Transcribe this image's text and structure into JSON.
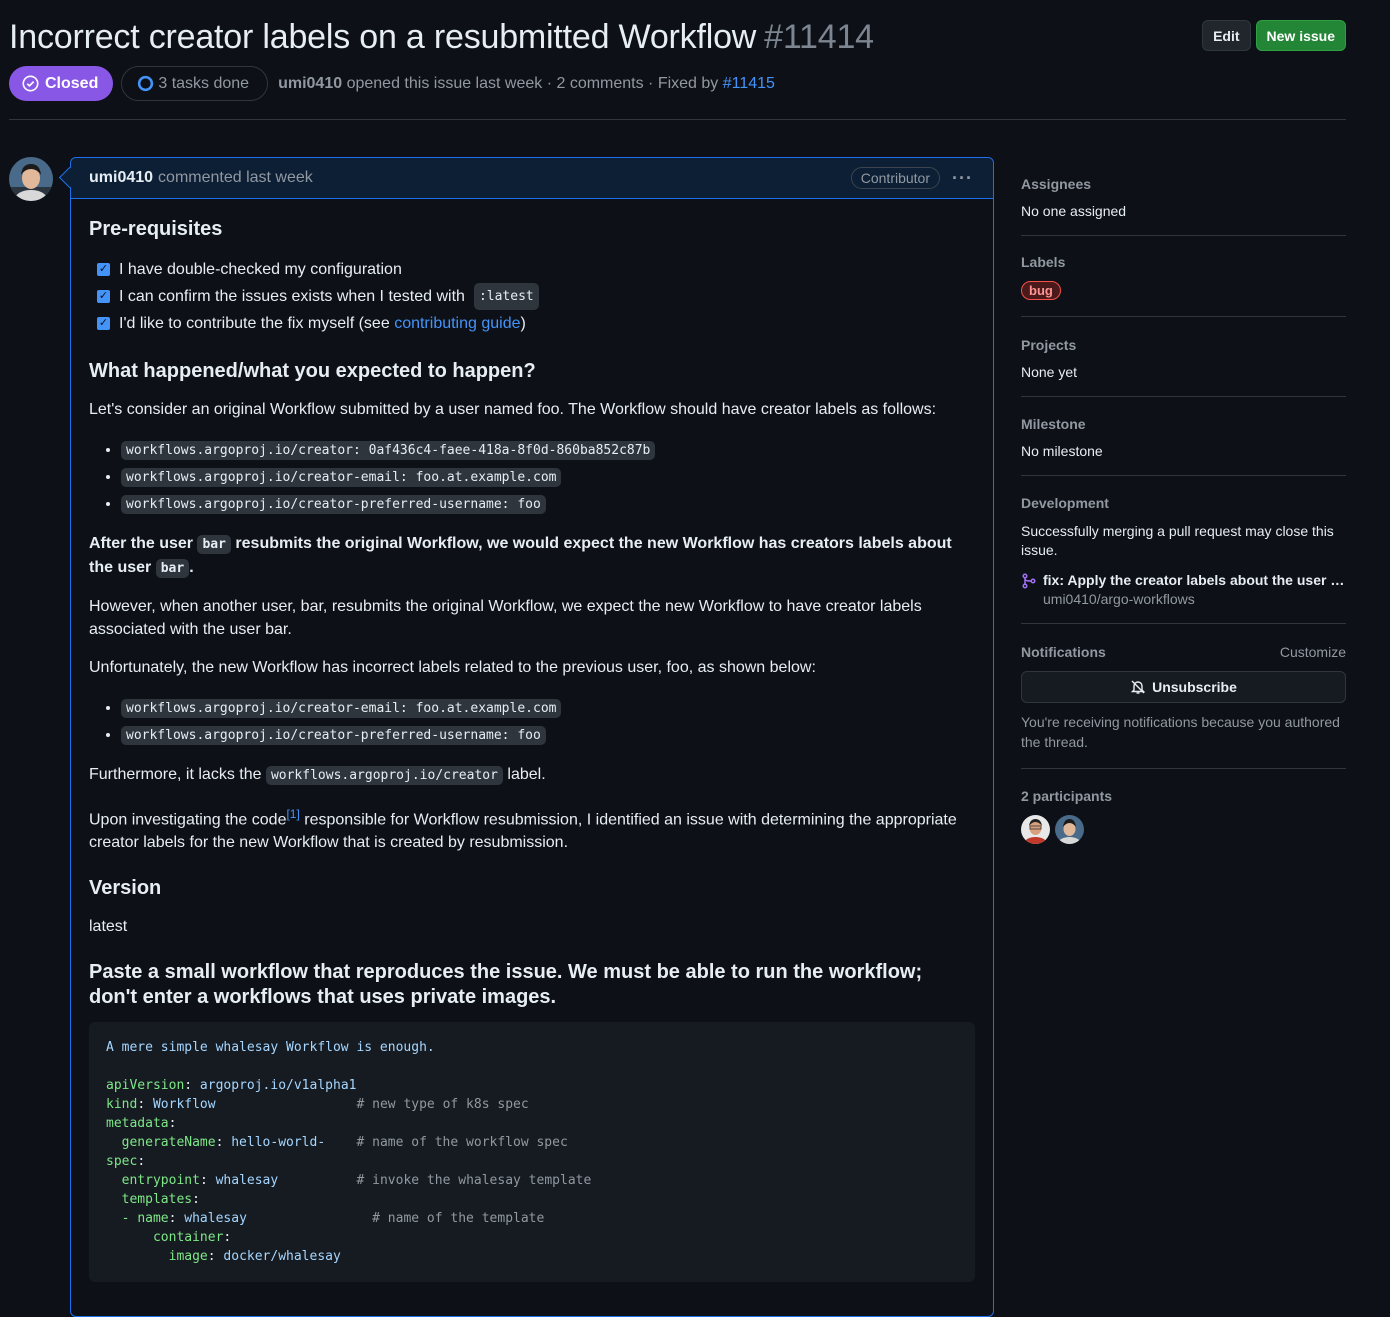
{
  "header": {
    "title": "Incorrect creator labels on a resubmitted Workflow",
    "number": "#11414",
    "edit_label": "Edit",
    "new_issue_label": "New issue",
    "state": "Closed",
    "tasks": "3 tasks done",
    "author": "umi0410",
    "opened_text": "opened this issue last week · 2 comments · Fixed by",
    "fixed_by": "#11415"
  },
  "comment": {
    "author": "umi0410",
    "when": "commented last week",
    "badge": "Contributor",
    "h_prereq": "Pre-requisites",
    "tasks": [
      "I have double-checked my configuration",
      "I can confirm the issues exists when I tested with",
      "I'd like to contribute the fix myself (see"
    ],
    "task2_code": ":latest",
    "task3_link": "contributing guide",
    "task3_close": ")",
    "h_what": "What happened/what you expected to happen?",
    "p1": "Let's consider an original Workflow submitted by a user named foo. The Workflow should have creator labels as follows:",
    "labels1": [
      "workflows.argoproj.io/creator: 0af436c4-faee-418a-8f0d-860ba852c87b",
      "workflows.argoproj.io/creator-email: foo.at.example.com",
      "workflows.argoproj.io/creator-preferred-username: foo"
    ],
    "bold_a": "After the user",
    "bold_code": "bar",
    "bold_b": "resubmits the original Workflow, we would expect the new Workflow has creators labels about the user",
    "bold_code2": "bar",
    "bold_end": ".",
    "p2": "However, when another user, bar, resubmits the original Workflow, we expect the new Workflow to have creator labels associated with the user bar.",
    "p3": "Unfortunately, the new Workflow has incorrect labels related to the previous user, foo, as shown below:",
    "labels2": [
      "workflows.argoproj.io/creator-email: foo.at.example.com",
      "workflows.argoproj.io/creator-preferred-username: foo"
    ],
    "p4a": "Furthermore, it lacks the",
    "p4code": "workflows.argoproj.io/creator",
    "p4b": "label.",
    "p5a": "Upon investigating the code",
    "p5sup": "[1]",
    "p5b": "responsible for Workflow resubmission, I identified an issue with determining the appropriate creator labels for the new Workflow that is created by resubmission.",
    "h_version": "Version",
    "version": "latest",
    "h_paste": "Paste a small workflow that reproduces the issue. We must be able to run the workflow; don't enter a workflows that uses private images.",
    "code_intro": "A mere simple whalesay Workflow is enough.",
    "code_lines": [
      {
        "key": "apiVersion",
        "val": "argoproj.io/v1alpha1",
        "indent": "",
        "comment": ""
      },
      {
        "key": "kind",
        "val": "Workflow",
        "indent": "",
        "comment": "# new type of k8s spec"
      },
      {
        "key": "metadata",
        "val": "",
        "indent": "",
        "comment": ""
      },
      {
        "key": "generateName",
        "val": "hello-world-",
        "indent": "  ",
        "comment": "# name of the workflow spec"
      },
      {
        "key": "spec",
        "val": "",
        "indent": "",
        "comment": ""
      },
      {
        "key": "entrypoint",
        "val": "whalesay",
        "indent": "  ",
        "comment": "# invoke the whalesay template"
      },
      {
        "key": "templates",
        "val": "",
        "indent": "  ",
        "comment": ""
      },
      {
        "key": "name",
        "val": "whalesay",
        "indent": "  - ",
        "comment": "# name of the template"
      },
      {
        "key": "container",
        "val": "",
        "indent": "      ",
        "comment": ""
      },
      {
        "key": "image",
        "val": "docker/whalesay",
        "indent": "        ",
        "comment": ""
      }
    ]
  },
  "sidebar": {
    "assignees_title": "Assignees",
    "assignees_val": "No one assigned",
    "labels_title": "Labels",
    "label_bug": "bug",
    "projects_title": "Projects",
    "projects_val": "None yet",
    "milestone_title": "Milestone",
    "milestone_val": "No milestone",
    "dev_title": "Development",
    "dev_desc": "Successfully merging a pull request may close this issue.",
    "dev_pr_title": "fix: Apply the creator labels about the user w...",
    "dev_pr_repo": "umi0410/argo-workflows",
    "notif_title": "Notifications",
    "notif_customize": "Customize",
    "unsubscribe": "Unsubscribe",
    "notif_note": "You're receiving notifications because you authored the thread.",
    "participants_title": "2 participants"
  },
  "colors": {
    "bg": "#0d1117",
    "accent": "#4493f8",
    "closed": "#8957e5",
    "green": "#238636"
  }
}
